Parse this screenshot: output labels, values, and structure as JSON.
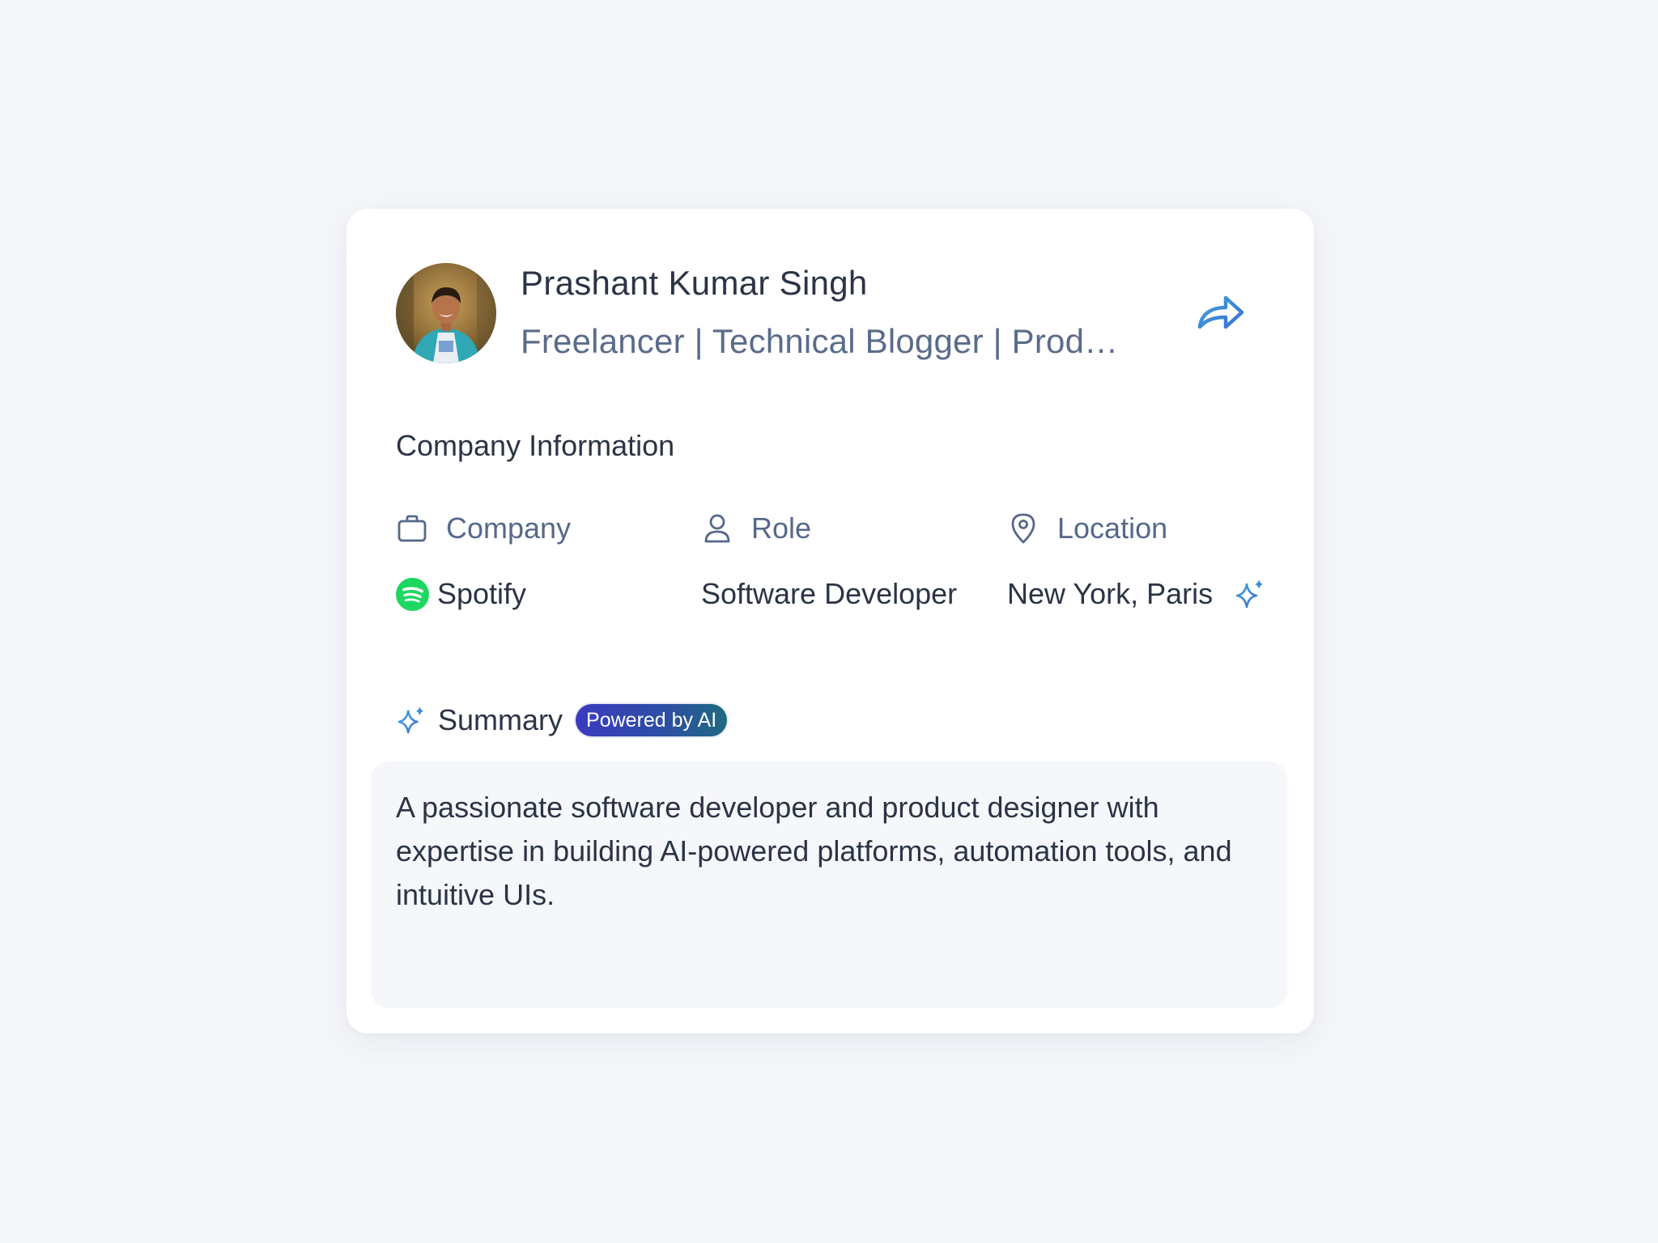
{
  "profile": {
    "name": "Prashant Kumar Singh",
    "headline": "Freelancer | Technical Blogger | Product Designer"
  },
  "company_info": {
    "section_title": "Company Information",
    "columns": [
      {
        "label": "Company",
        "icon": "briefcase-icon",
        "value": "Spotify",
        "value_icon": "spotify-logo-icon"
      },
      {
        "label": "Role",
        "icon": "user-icon",
        "value": "Software Developer"
      },
      {
        "label": "Location",
        "icon": "map-pin-icon",
        "value": "New York, Paris",
        "value_icon": "sparkle-icon"
      }
    ]
  },
  "summary": {
    "label": "Summary",
    "badge": "Powered by AI",
    "text": "A passionate software developer and product designer with expertise in building AI-powered platforms, automation tools, and intuitive UIs."
  },
  "colors": {
    "background": "#f4f6fa",
    "card": "#ffffff",
    "text_primary": "#2b3445",
    "text_secondary": "#56688a",
    "accent": "#3a8fd0",
    "spotify_green": "#1ed760",
    "badge_gradient_start": "#3a3bbf",
    "badge_gradient_end": "#1f6a80"
  }
}
